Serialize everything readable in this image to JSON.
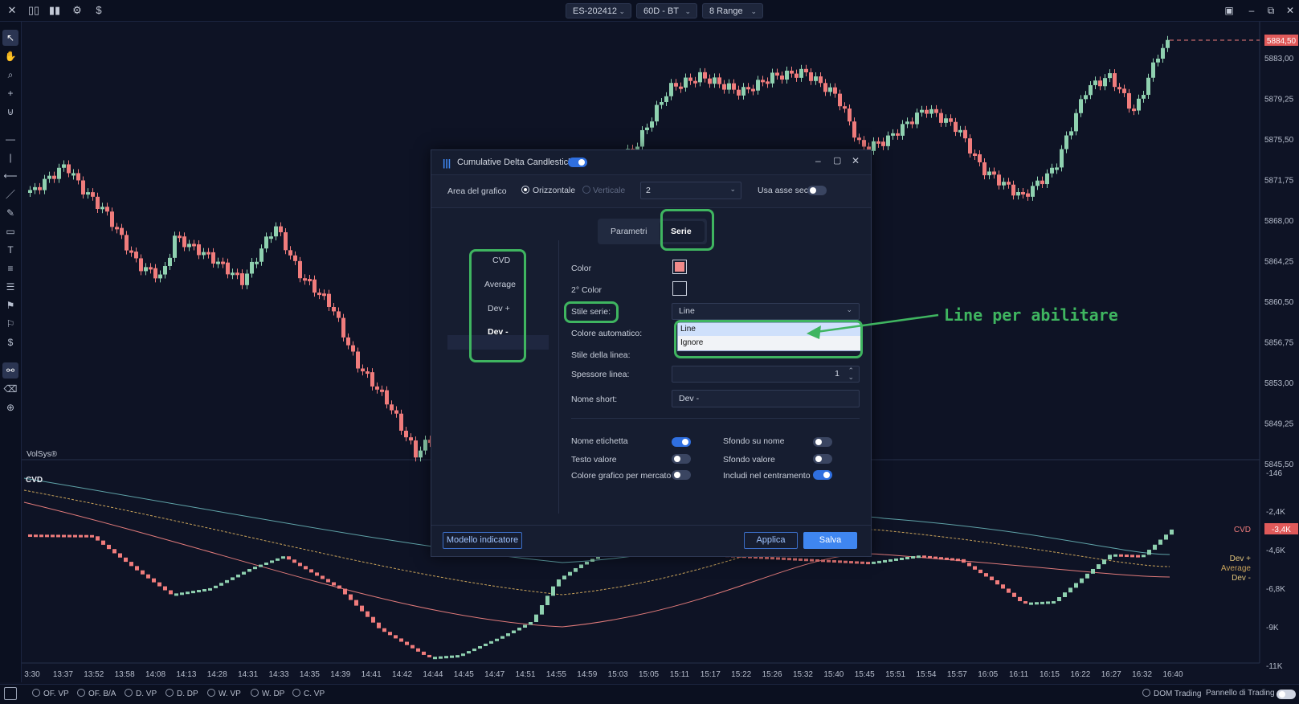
{
  "toolbar": {
    "symbol": "ES-202412",
    "timeframe": "60D - BT",
    "range": "8 Range",
    "icons": [
      "close-icon",
      "layout-icon",
      "bar-chart-icon",
      "settings-icon",
      "dollar-icon"
    ]
  },
  "chart": {
    "watermark": "VolSys®",
    "current_price": "5884,50",
    "price_ticks": [
      "5883,00",
      "5879,25",
      "5875,50",
      "5871,75",
      "5868,00",
      "5864,25",
      "5860,50",
      "5856,75",
      "5853,00",
      "5849,25",
      "5845,50"
    ],
    "cvd_ticks": [
      "-146",
      "-2,4K",
      "-4,6K",
      "-6,8K",
      "-9K",
      "-11K"
    ],
    "cvd_label": "CVD",
    "cvd_current": "-3,4K",
    "legend": {
      "cvd": "CVD",
      "dev_plus": "Dev +",
      "average": "Average",
      "dev_minus": "Dev -"
    },
    "time_ticks": [
      "3:30",
      "13:37",
      "13:52",
      "13:58",
      "14:08",
      "14:13",
      "14:28",
      "14:31",
      "14:33",
      "14:35",
      "14:39",
      "14:41",
      "14:42",
      "14:44",
      "14:45",
      "14:47",
      "14:51",
      "14:55",
      "14:59",
      "15:03",
      "15:05",
      "15:11",
      "15:17",
      "15:22",
      "15:26",
      "15:32",
      "15:40",
      "15:45",
      "15:51",
      "15:54",
      "15:57",
      "16:05",
      "16:11",
      "16:15",
      "16:22",
      "16:27",
      "16:32",
      "16:40"
    ]
  },
  "dialog": {
    "title": "Cumulative Delta Candlestick",
    "area_label": "Area del grafico",
    "orientation_h": "Orizzontale",
    "orientation_v": "Verticale",
    "area_value": "2",
    "sec_axis_label": "Usa asse sec.",
    "tabs": {
      "params": "Parametri",
      "series": "Serie"
    },
    "series_list": [
      "CVD",
      "Average",
      "Dev +",
      "Dev -"
    ],
    "fields": {
      "color": "Color",
      "color2": "2° Color",
      "style": "Stile serie:",
      "style_value": "Line",
      "auto_color": "Colore automatico:",
      "line_style": "Stile della linea:",
      "thickness": "Spessore linea:",
      "thickness_value": "1",
      "short_name": "Nome short:",
      "short_name_value": "Dev -"
    },
    "dropdown_options": [
      "Line",
      "Ignore"
    ],
    "toggles": {
      "label_name": "Nome etichetta",
      "value_text": "Testo valore",
      "market_color": "Colore grafico per mercato",
      "bg_name": "Sfondo su nome",
      "bg_value": "Sfondo valore",
      "include_center": "Includi nel centramento"
    },
    "template_button": "Modello indicatore",
    "apply_button": "Applica",
    "save_button": "Salva",
    "color_swatch": "#f08a8a"
  },
  "annotation": "Line per abilitare",
  "bottom": {
    "items": [
      "OF. VP",
      "OF. B/A",
      "D. VP",
      "D. DP",
      "W. VP",
      "W. DP",
      "C. VP"
    ],
    "dom": "DOM Trading",
    "panel": "Pannello di Trading"
  },
  "colors": {
    "up": "#8fd1b0",
    "down": "#f07c7c",
    "annotation": "#3fb560",
    "accent": "#3f86f0"
  }
}
